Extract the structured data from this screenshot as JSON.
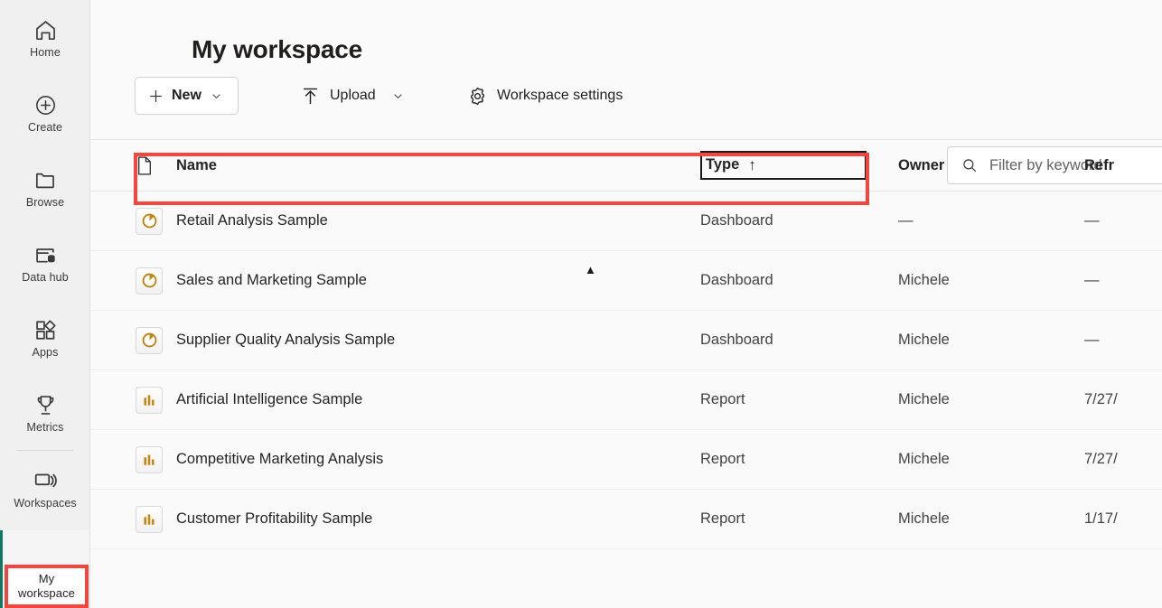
{
  "sidebar": {
    "items": [
      {
        "label": "Home",
        "icon": "home-icon"
      },
      {
        "label": "Create",
        "icon": "create-plus-circle-icon"
      },
      {
        "label": "Browse",
        "icon": "folder-icon"
      },
      {
        "label": "Data hub",
        "icon": "data-hub-icon"
      },
      {
        "label": "Apps",
        "icon": "apps-grid-icon"
      },
      {
        "label": "Metrics",
        "icon": "trophy-icon"
      },
      {
        "label": "Workspaces",
        "icon": "workspaces-stack-icon"
      }
    ],
    "selected_workspace": {
      "line1": "My",
      "line2": "workspace",
      "accent_color": "#0e7a64",
      "highlight_color": "#f4453f"
    }
  },
  "header": {
    "title": "My workspace"
  },
  "toolbar": {
    "new_label": "New",
    "upload_label": "Upload",
    "settings_label": "Workspace settings"
  },
  "search": {
    "placeholder": "Filter by keyword",
    "value": ""
  },
  "table": {
    "columns": {
      "name": "Name",
      "type": "Type",
      "owner": "Owner",
      "refreshed": "Refr"
    },
    "sort": {
      "column": "Type",
      "direction": "ascending",
      "arrow": "↑"
    },
    "rows": [
      {
        "icon": "dashboard-gauge-icon",
        "name": "Retail Analysis Sample",
        "type": "Dashboard",
        "owner": "—",
        "refreshed": "—",
        "highlighted": false
      },
      {
        "icon": "dashboard-gauge-icon",
        "name": "Sales and Marketing Sample",
        "type": "Dashboard",
        "owner": "Michele",
        "refreshed": "—",
        "highlighted": true
      },
      {
        "icon": "dashboard-gauge-icon",
        "name": "Supplier Quality Analysis Sample",
        "type": "Dashboard",
        "owner": "Michele",
        "refreshed": "—",
        "highlighted": false
      },
      {
        "icon": "report-bar-chart-icon",
        "name": "Artificial Intelligence Sample",
        "type": "Report",
        "owner": "Michele",
        "refreshed": "7/27/",
        "highlighted": false
      },
      {
        "icon": "report-bar-chart-icon",
        "name": "Competitive Marketing Analysis",
        "type": "Report",
        "owner": "Michele",
        "refreshed": "7/27/",
        "highlighted": false
      },
      {
        "icon": "report-bar-chart-icon",
        "name": "Customer Profitability Sample",
        "type": "Report",
        "owner": "Michele",
        "refreshed": "1/17/",
        "highlighted": false
      }
    ]
  },
  "colors": {
    "accent_teal": "#0e7a64",
    "annotation_red": "#f4453f",
    "icon_amber": "#c8860d",
    "sidebar_bg": "#f0f0f0",
    "content_bg": "#fafafa"
  }
}
